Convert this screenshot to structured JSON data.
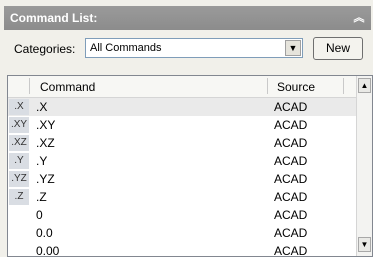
{
  "panel": {
    "title": "Command List:",
    "collapse_icon": "double-chevron-up-icon"
  },
  "categories": {
    "label": "Categories:",
    "selected": "All Commands",
    "dropdown_icon": "chevron-down-icon"
  },
  "new_button": {
    "label": "New"
  },
  "list": {
    "columns": {
      "command": "Command",
      "source": "Source"
    },
    "rows": [
      {
        "icon": ".X",
        "command": ".X",
        "source": "ACAD",
        "selected": true
      },
      {
        "icon": ".XY",
        "command": ".XY",
        "source": "ACAD"
      },
      {
        "icon": ".XZ",
        "command": ".XZ",
        "source": "ACAD"
      },
      {
        "icon": ".Y",
        "command": ".Y",
        "source": "ACAD"
      },
      {
        "icon": ".YZ",
        "command": ".YZ",
        "source": "ACAD"
      },
      {
        "icon": ".Z",
        "command": ".Z",
        "source": "ACAD"
      },
      {
        "icon": "",
        "command": "0",
        "source": "ACAD"
      },
      {
        "icon": "",
        "command": "0.0",
        "source": "ACAD"
      },
      {
        "icon": "",
        "command": "0.00",
        "source": "ACAD"
      }
    ]
  },
  "scrollbar": {
    "up_icon": "scroll-up-arrow-icon",
    "down_icon": "scroll-down-arrow-icon"
  }
}
